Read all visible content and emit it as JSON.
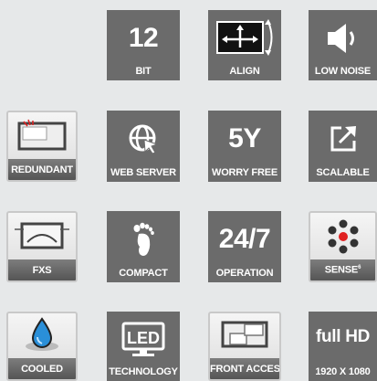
{
  "tiles": {
    "bit": {
      "value": "12",
      "label": "BIT"
    },
    "align": {
      "label": "ALIGN",
      "icon": "monitor-align-icon"
    },
    "low_noise": {
      "label": "LOW NOISE",
      "icon": "speaker-icon"
    },
    "redundant": {
      "label": "REDUNDANT",
      "icon": "redundant-display-icon"
    },
    "web_server": {
      "label": "WEB SERVER",
      "icon": "globe-cursor-icon"
    },
    "worry_free": {
      "value": "5Y",
      "label": "WORRY FREE"
    },
    "scalable": {
      "label": "SCALABLE",
      "icon": "expand-arrow-icon"
    },
    "fxs": {
      "label": "FXS",
      "icon": "fxs-display-icon"
    },
    "compact": {
      "label": "COMPACT",
      "icon": "footprint-icon"
    },
    "operation": {
      "value": "24/7",
      "label": "OPERATION"
    },
    "sense": {
      "label": "SENSE",
      "superscript": "6",
      "icon": "sensor-dots-icon"
    },
    "cooled": {
      "label": "COOLED",
      "icon": "water-drop-icon"
    },
    "technology": {
      "value": "LED",
      "label": "TECHNOLOGY"
    },
    "front_access": {
      "label": "FRONT ACCESS",
      "icon": "front-access-icon"
    },
    "full_hd": {
      "value": "full HD",
      "label": "1920 X 1080"
    }
  },
  "colors": {
    "background": "#e6e8e9",
    "tile": "#6b6b6b",
    "accent_red": "#e02020",
    "accent_blue": "#2a8fd8"
  }
}
